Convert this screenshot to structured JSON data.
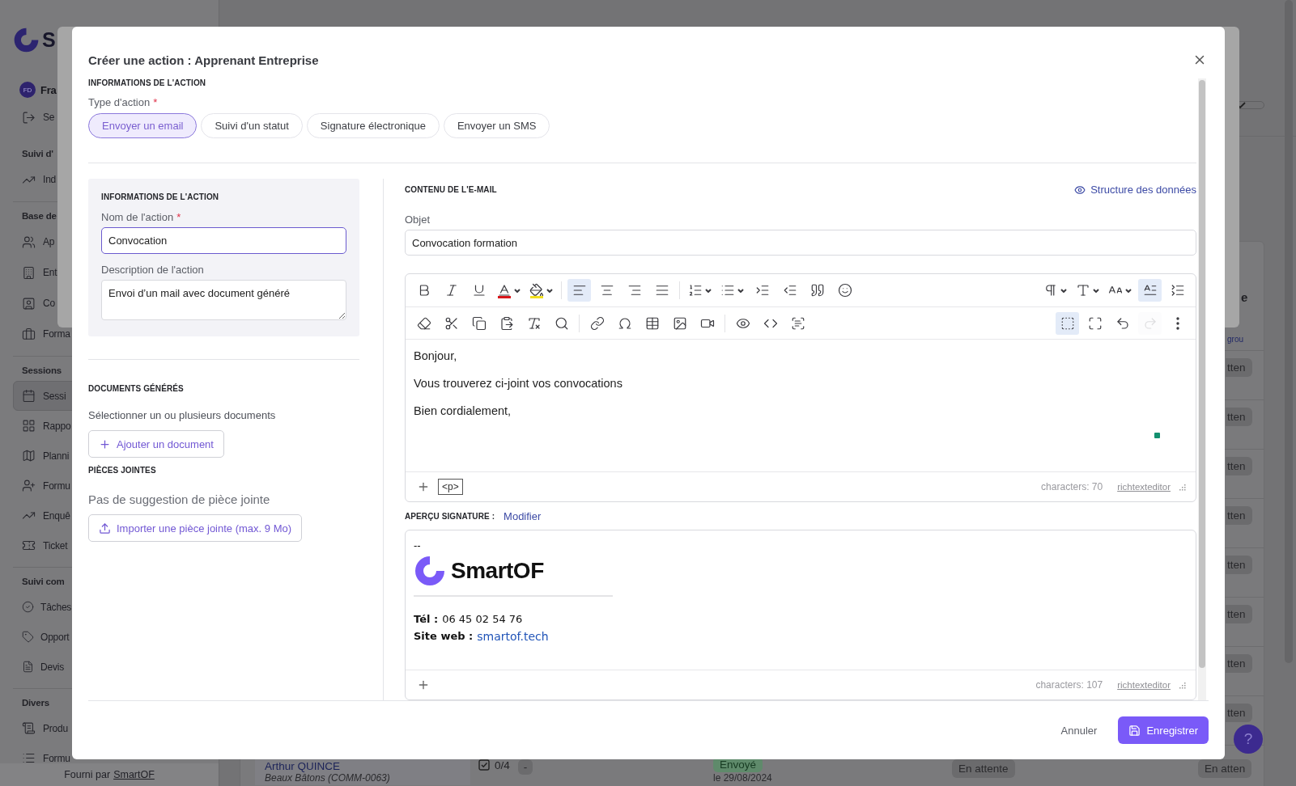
{
  "sidebar": {
    "logo_text": "S",
    "user": {
      "initials": "FD",
      "name": "Fra"
    },
    "sections": [
      {
        "items": [
          {
            "label": "Se",
            "selected": false
          }
        ]
      },
      {
        "title": "Suivi d'",
        "items": [
          {
            "label": "Ind",
            "selected": false
          }
        ]
      },
      {
        "title": "Base de",
        "items": [
          {
            "label": "Ap",
            "selected": false
          },
          {
            "label": "Ent",
            "selected": false
          },
          {
            "label": "Co",
            "selected": false
          },
          {
            "label": "Forma",
            "selected": false
          }
        ]
      },
      {
        "title": "Sessions",
        "items": [
          {
            "label": "Sessi",
            "selected": true
          },
          {
            "label": "Rappo",
            "selected": false
          },
          {
            "label": "Planni",
            "selected": false
          },
          {
            "label": "Formu",
            "selected": false
          },
          {
            "label": "Enquê",
            "selected": false
          },
          {
            "label": "Ticket",
            "selected": false
          }
        ]
      },
      {
        "title": "Suivi com",
        "items": [
          {
            "label": "Tâches",
            "selected": false
          },
          {
            "label": "Opport",
            "selected": false
          },
          {
            "label": "Devis",
            "selected": false
          }
        ]
      },
      {
        "title": "Divers",
        "items": [
          {
            "label": "Produ",
            "selected": false
          },
          {
            "label": "Formu",
            "selected": false
          }
        ]
      }
    ],
    "footer": {
      "text": "Fourni par",
      "link": "SmartOF"
    }
  },
  "table": {
    "header_title": "e",
    "header_link": "grou",
    "side_badges": [
      "tten",
      "tten",
      "tten",
      "tten",
      "tten",
      "tten",
      "tten",
      "tten"
    ],
    "last_row": {
      "name": "Arthur QUINCE",
      "company": "Beaux Bâtons (COMM-0063)",
      "tasks": "0/4",
      "tasks_badge": "-",
      "status": "Envoyé",
      "date": "le 29/08/2024",
      "status_2": "En attente",
      "status_3": "En atten"
    }
  },
  "help_button": "?",
  "modal": {
    "title": "Créer une action : Apprenant Entreprise",
    "section_title": "INFORMATIONS DE L'ACTION",
    "type_label": "Type d'action",
    "required_mark": "*",
    "type_tabs": [
      {
        "label": "Envoyer un email",
        "selected": true
      },
      {
        "label": "Suivi d'un statut",
        "selected": false
      },
      {
        "label": "Signature électronique",
        "selected": false
      },
      {
        "label": "Envoyer un SMS",
        "selected": false
      }
    ],
    "info_card": {
      "title": "INFORMATIONS DE L'ACTION",
      "name_label": "Nom de l'action",
      "required_mark": "*",
      "name_value": "Convocation",
      "description_label": "Description de l'action",
      "description_value": "Envoi d’un mail avec document généré"
    },
    "documents": {
      "title": "DOCUMENTS GÉNÉRÉS",
      "hint": "Sélectionner un ou plusieurs documents",
      "button": "Ajouter un document"
    },
    "attachments": {
      "title": "PIÈCES JOINTES",
      "empty": "Pas de suggestion de pièce jointe",
      "button": "Importer une pièce jointe (max. 9 Mo)"
    },
    "email": {
      "title": "CONTENU DE L'E-MAIL",
      "structure_link": "Structure des données",
      "subject_label": "Objet",
      "subject_value": "Convocation formation"
    },
    "editor": {
      "toolbar_rows": [
        {
          "left": [
            {
              "kind": "bold",
              "dropdown": false,
              "active": false,
              "disabled": false
            },
            {
              "kind": "italic",
              "dropdown": false,
              "active": false,
              "disabled": false
            },
            {
              "kind": "underline",
              "dropdown": false,
              "active": false,
              "disabled": false
            },
            {
              "kind": "font-color",
              "dropdown": true,
              "active": false,
              "disabled": false
            },
            {
              "kind": "highlight",
              "dropdown": true,
              "active": false,
              "disabled": false
            },
            {
              "kind": "separator"
            },
            {
              "kind": "align-left",
              "dropdown": false,
              "active": true,
              "disabled": false
            },
            {
              "kind": "align-center",
              "dropdown": false,
              "active": false,
              "disabled": false
            },
            {
              "kind": "align-right",
              "dropdown": false,
              "active": false,
              "disabled": false
            },
            {
              "kind": "align-justify",
              "dropdown": false,
              "active": false,
              "disabled": false
            },
            {
              "kind": "separator"
            },
            {
              "kind": "ordered-list",
              "dropdown": true,
              "active": false,
              "disabled": false
            },
            {
              "kind": "bullet-list",
              "dropdown": true,
              "active": false,
              "disabled": false
            },
            {
              "kind": "indent",
              "dropdown": false,
              "active": false,
              "disabled": false
            },
            {
              "kind": "outdent",
              "dropdown": false,
              "active": false,
              "disabled": false
            },
            {
              "kind": "quote",
              "dropdown": false,
              "active": false,
              "disabled": false
            },
            {
              "kind": "emoji",
              "dropdown": false,
              "active": false,
              "disabled": false
            }
          ],
          "right": [
            {
              "kind": "paragraph",
              "dropdown": true,
              "active": false,
              "disabled": false
            },
            {
              "kind": "font-size",
              "dropdown": true,
              "active": false,
              "disabled": false
            },
            {
              "kind": "text-case",
              "dropdown": true,
              "active": false,
              "disabled": false
            },
            {
              "kind": "add-style",
              "dropdown": false,
              "active": true,
              "disabled": false
            },
            {
              "kind": "line-height",
              "dropdown": false,
              "active": false,
              "disabled": false
            }
          ]
        },
        {
          "left": [
            {
              "kind": "eraser",
              "dropdown": false,
              "active": false,
              "disabled": false
            },
            {
              "kind": "cut",
              "dropdown": false,
              "active": false,
              "disabled": false
            },
            {
              "kind": "copy",
              "dropdown": false,
              "active": false,
              "disabled": false
            },
            {
              "kind": "paste",
              "dropdown": false,
              "active": false,
              "disabled": false
            },
            {
              "kind": "remove-format",
              "dropdown": false,
              "active": false,
              "disabled": false
            },
            {
              "kind": "search",
              "dropdown": false,
              "active": false,
              "disabled": false
            },
            {
              "kind": "separator"
            },
            {
              "kind": "link",
              "dropdown": false,
              "active": false,
              "disabled": false
            },
            {
              "kind": "symbol",
              "dropdown": false,
              "active": false,
              "disabled": false
            },
            {
              "kind": "table",
              "dropdown": false,
              "active": false,
              "disabled": false
            },
            {
              "kind": "image",
              "dropdown": false,
              "active": false,
              "disabled": false
            },
            {
              "kind": "video",
              "dropdown": false,
              "active": false,
              "disabled": false
            },
            {
              "kind": "separator"
            },
            {
              "kind": "preview",
              "dropdown": false,
              "active": false,
              "disabled": false
            },
            {
              "kind": "code",
              "dropdown": false,
              "active": false,
              "disabled": false
            },
            {
              "kind": "select-all",
              "dropdown": false,
              "active": false,
              "disabled": false
            }
          ],
          "right": [
            {
              "kind": "selection",
              "dropdown": false,
              "active": true,
              "disabled": false
            },
            {
              "kind": "fullscreen",
              "dropdown": false,
              "active": false,
              "disabled": false
            },
            {
              "kind": "undo",
              "dropdown": false,
              "active": false,
              "disabled": false
            },
            {
              "kind": "redo",
              "dropdown": false,
              "active": false,
              "disabled": true
            },
            {
              "kind": "more",
              "dropdown": false,
              "active": false,
              "disabled": false
            }
          ]
        }
      ],
      "paragraphs": [
        "Bonjour,",
        "Vous trouverez ci-joint vos convocations",
        "Bien cordialement,"
      ],
      "tag": "<p>",
      "count": "characters: 70",
      "brand": "richtexteditor"
    },
    "signature": {
      "title": "APERÇU SIGNATURE :",
      "edit_link": "Modifier",
      "dash": "--",
      "logo_text": "SmartOF",
      "phone": {
        "label": "Tél :",
        "value": "06 45 02 54 76"
      },
      "site": {
        "label": "Site web :",
        "link": "smartof.tech"
      },
      "count": "characters: 107",
      "brand": "richtexteditor"
    },
    "cancel": "Annuler",
    "save": "Enregistrer"
  }
}
